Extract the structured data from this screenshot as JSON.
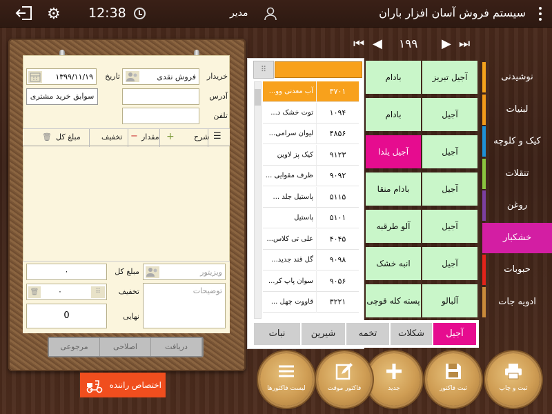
{
  "header": {
    "title": "سیستم فروش آسان افزار باران",
    "user_name": "مدیر",
    "time": "12:38"
  },
  "pager": {
    "page": "۱۹۹"
  },
  "invoice": {
    "buyer_label": "خریدار",
    "buyer_value": "فروش نقدی",
    "date_label": "تاریخ",
    "date_value": "۱۳۹۹/۱۱/۱۹",
    "address_label": "آدرس",
    "phone_label": "تلفن",
    "history_button": "سوابق خرید مشتری",
    "columns": {
      "desc": "شرح",
      "qty": "مقدار",
      "discount": "تخفیف",
      "total": "مبلغ کل"
    },
    "visitor_placeholder": "ویزیتور",
    "notes_placeholder": "توضیحات",
    "sum_label": "مبلغ کل",
    "sum_value": "۰",
    "discount_label": "تخفیف",
    "discount_value": "۰",
    "final_label": "نهایی",
    "final_value": "0",
    "actions": [
      "دریافت",
      "اصلاحی",
      "مرجوعی"
    ],
    "assign_driver": "اختصاص راننده"
  },
  "list": {
    "rows": [
      {
        "name": "آب معدنی وو...",
        "code": "۳۷۰۱",
        "selected": true
      },
      {
        "name": "توت خشک د...",
        "code": "۱۰۹۴"
      },
      {
        "name": "لیوان سرامی...",
        "code": "۴۸۵۶"
      },
      {
        "name": "کیک پز لاوین",
        "code": "۹۱۲۳"
      },
      {
        "name": "ظرف مقوایی ...",
        "code": "۹۰۹۲"
      },
      {
        "name": "پاستیل جلد ...",
        "code": "۵۱۱۵"
      },
      {
        "name": "پاستیل",
        "code": "۵۱۰۱"
      },
      {
        "name": "علی تی کلاس...",
        "code": "۴۰۴۵"
      },
      {
        "name": "گل قند جدید...",
        "code": "۹۰۹۸"
      },
      {
        "name": "سوان پاپ کر...",
        "code": "۹۰۵۶"
      },
      {
        "name": "قاووت چهل ...",
        "code": "۳۲۲۱"
      }
    ]
  },
  "products": [
    {
      "label": "آجیل تبریز",
      "col": 0,
      "row": 0
    },
    {
      "label": "بادام",
      "col": 1,
      "row": 0
    },
    {
      "label": "آجیل",
      "col": 0,
      "row": 1
    },
    {
      "label": "بادام",
      "col": 1,
      "row": 1
    },
    {
      "label": "آجیل",
      "col": 0,
      "row": 2
    },
    {
      "label": "آجیل یلدا",
      "col": 1,
      "row": 2,
      "selected": true
    },
    {
      "label": "آجیل",
      "col": 0,
      "row": 3
    },
    {
      "label": "بادام منقا",
      "col": 1,
      "row": 3
    },
    {
      "label": "آجیل",
      "col": 0,
      "row": 4
    },
    {
      "label": "آلو طرقبه",
      "col": 1,
      "row": 4
    },
    {
      "label": "آجیل",
      "col": 0,
      "row": 5
    },
    {
      "label": "انبه خشک",
      "col": 1,
      "row": 5
    },
    {
      "label": "آلبالو",
      "col": 0,
      "row": 6
    },
    {
      "label": "پسته کله قوچی",
      "col": 1,
      "row": 6
    }
  ],
  "categories": [
    {
      "label": "نوشیدنی",
      "color": "#f4a21c"
    },
    {
      "label": "لبنیات",
      "color": "#f29a1a"
    },
    {
      "label": "کیک و کلوچه",
      "color": "#1e90d6"
    },
    {
      "label": "تنقلات",
      "color": "#8ac43f"
    },
    {
      "label": "روغن",
      "color": "#7b3fa0"
    },
    {
      "label": "خشکبار",
      "color": "#d31ea3",
      "selected": true
    },
    {
      "label": "حبوبات",
      "color": "#e2231a"
    },
    {
      "label": "ادویه جات",
      "color": "#c98a3a"
    }
  ],
  "tabs": [
    {
      "label": "آجیل",
      "selected": true
    },
    {
      "label": "شکلات"
    },
    {
      "label": "تخمه"
    },
    {
      "label": "شیرین"
    },
    {
      "label": "نبات"
    }
  ],
  "round_buttons": [
    {
      "label": "ثبت و چاپ",
      "icon": "printer-icon"
    },
    {
      "label": "ثبت فاکتور",
      "icon": "save-icon"
    },
    {
      "label": "جدید",
      "icon": "plus-icon"
    },
    {
      "label": "فاکتور موقت",
      "icon": "edit-icon"
    },
    {
      "label": "لیست فاکتورها",
      "icon": "list-icon"
    }
  ],
  "colors": {
    "accent_orange": "#f8a11c",
    "accent_magenta": "#e60c8f",
    "product_green": "#c9f6c9",
    "assign_orange": "#f04e1e"
  }
}
